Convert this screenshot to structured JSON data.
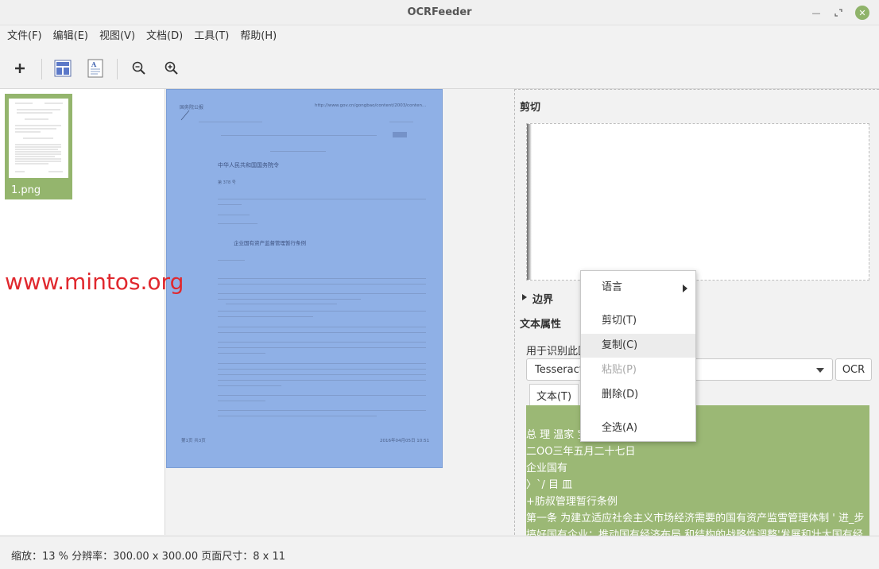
{
  "window": {
    "title": "OCRFeeder",
    "min_icon": "minimize-icon",
    "max_icon": "maximize-icon",
    "close_icon": "close-icon"
  },
  "menu": [
    {
      "label": "文件(F)"
    },
    {
      "label": "编辑(E)"
    },
    {
      "label": "视图(V)"
    },
    {
      "label": "文档(D)"
    },
    {
      "label": "工具(T)"
    },
    {
      "label": "帮助(H)"
    }
  ],
  "toolbar": {
    "icons": [
      "add-icon",
      "layout-detect-icon",
      "document-text-icon",
      "zoom-out-icon",
      "zoom-in-icon"
    ]
  },
  "thumbnails": [
    {
      "label": "1.png"
    }
  ],
  "watermark": "www.mintos.org",
  "page_preview": {
    "header_left": "国务院公报",
    "header_right": "http://www.gov.cn/gongbao/content/2003/conten...",
    "doc_title": "中华人民共和国国务院令",
    "doc_number": "第 378 号",
    "regulation_title": "企业国有资产监督管理暂行条例",
    "footer_left": "第1页 共3页",
    "footer_right": "2016年04月05日 10:51"
  },
  "right_panel": {
    "crop_title": "剪切",
    "border_title": "边界",
    "text_props_title": "文本属性",
    "recognize_label": "用于识别此区",
    "engine_value": "Tesseract",
    "ocr_button": "OCR",
    "tab_text": "文本(T)",
    "ocr_lines": [
      "总 理 温家 宝",
      "二OO三年五月二十七日",
      "企业国有",
      "〉`/ 目 皿",
      "+肪叔管理暂行条例",
      "第一条 为建立适应社会主义市场经济需要的国有资产监雪管理体制 ' 进_步",
      "搞好国有企业；推动国有经济布局 和结构的战略性调整'发展和壮大国有经"
    ]
  },
  "context_menu": {
    "items": [
      {
        "label": "语言",
        "submenu": true
      },
      {
        "label": "剪切(T)"
      },
      {
        "label": "复制(C)",
        "hover": true
      },
      {
        "label": "粘贴(P)",
        "disabled": true
      },
      {
        "label": "删除(D)"
      },
      {
        "label": "全选(A)"
      }
    ]
  },
  "status": {
    "text": "缩放：13 % 分辨率：300.00 x 300.00 页面尺寸：8 x 11"
  },
  "colors": {
    "accent_green": "#94b56d",
    "page_blue": "#8fb0e6",
    "watermark_red": "#e0282e"
  }
}
